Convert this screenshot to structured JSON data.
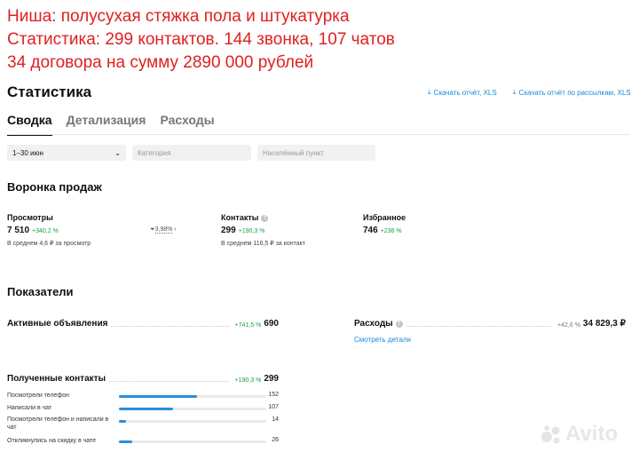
{
  "caption": {
    "line1": "Ниша: полусухая стяжка пола и штукатурка",
    "line2": "Статистика: 299 контактов. 144 звонка, 107 чатов",
    "line3": "34 договора на сумму 2890 000 рублей"
  },
  "header": {
    "title": "Статистика",
    "download_report": "Скачать отчёт, XLS",
    "download_mailing_report": "Скачать отчёт по рассылкам, XLS"
  },
  "tabs": [
    {
      "label": "Сводка",
      "active": true
    },
    {
      "label": "Детализация",
      "active": false
    },
    {
      "label": "Расходы",
      "active": false
    }
  ],
  "filters": {
    "period": "1–30 июн",
    "category_placeholder": "Категория",
    "city_placeholder": "Населённый пункт"
  },
  "funnel": {
    "title": "Воронка продаж",
    "views": {
      "label": "Просмотры",
      "value": "7 510",
      "delta": "+340,2 %",
      "note": "В среднем 4,6 ₽ за просмотр"
    },
    "conversion": "3,98%",
    "contacts": {
      "label": "Контакты",
      "value": "299",
      "delta": "+190,3 %",
      "note": "В среднем 116,5 ₽ за контакт"
    },
    "favorites": {
      "label": "Избранное",
      "value": "746",
      "delta": "+236 %"
    }
  },
  "metrics": {
    "title": "Показатели",
    "active_ads": {
      "label": "Активные объявления",
      "delta": "+741,5 %",
      "value": "690"
    },
    "expenses": {
      "label": "Расходы",
      "delta": "+42,6 %",
      "value": "34 829,3 ₽",
      "link": "Смотреть детали"
    },
    "received_contacts": {
      "label": "Полученные контакты",
      "delta": "+190,3 %",
      "value": "299"
    },
    "breakdown": [
      {
        "label": "Посмотрели телефон",
        "value": "152",
        "fraction": 0.53
      },
      {
        "label": "Написали в чат",
        "value": "107",
        "fraction": 0.37
      },
      {
        "label": "Посмотрели телефон и написали в чат",
        "value": "14",
        "fraction": 0.05
      },
      {
        "label": "Откликнулись на скидку в чате",
        "value": "26",
        "fraction": 0.09
      }
    ]
  },
  "watermark": "Avito",
  "colors": {
    "accent": "#1a88d8",
    "positive": "#18a048",
    "caption": "#e02020",
    "bar": "#2a8fd8"
  }
}
